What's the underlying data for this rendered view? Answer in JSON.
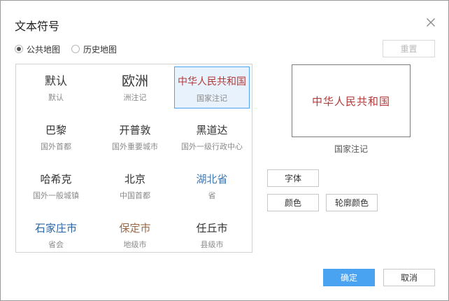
{
  "dialog": {
    "title": "文本符号"
  },
  "map_type": {
    "options": [
      {
        "label": "公共地图",
        "selected": true
      },
      {
        "label": "历史地图",
        "selected": false
      }
    ],
    "reset_label": "重置"
  },
  "symbols": [
    {
      "name": "默认",
      "sub": "默认",
      "color": "#333333",
      "selected": false
    },
    {
      "name": "欧洲",
      "sub": "洲注记",
      "color": "#333333",
      "selected": false
    },
    {
      "name": "中华人民共和国",
      "sub": "国家注记",
      "color": "#b23a3a",
      "selected": true
    },
    {
      "name": "巴黎",
      "sub": "国外首都",
      "color": "#333333",
      "selected": false
    },
    {
      "name": "开普敦",
      "sub": "国外重要城市",
      "color": "#333333",
      "selected": false
    },
    {
      "name": "黑道达",
      "sub": "国外一级行政中心",
      "color": "#333333",
      "selected": false
    },
    {
      "name": "哈希克",
      "sub": "国外一般城镇",
      "color": "#333333",
      "selected": false
    },
    {
      "name": "北京",
      "sub": "中国首都",
      "color": "#333333",
      "selected": false
    },
    {
      "name": "湖北省",
      "sub": "省",
      "color": "#3c78b4",
      "selected": false
    },
    {
      "name": "石家庄市",
      "sub": "省会",
      "color": "#2a64a6",
      "selected": false
    },
    {
      "name": "保定市",
      "sub": "地级市",
      "color": "#9a6a48",
      "selected": false
    },
    {
      "name": "任丘市",
      "sub": "县级市",
      "color": "#333333",
      "selected": false
    }
  ],
  "preview": {
    "text": "中华人民共和国",
    "caption": "国家注记",
    "color": "#b23a3a"
  },
  "style_buttons": {
    "font": "字体",
    "color": "颜色",
    "outline_color": "轮廓颜色"
  },
  "footer": {
    "ok": "确定",
    "cancel": "取消"
  },
  "colors": {
    "accent": "#4aa3f0",
    "selected_bg": "#e8f2fc"
  },
  "icons": {
    "close": "close-icon"
  }
}
